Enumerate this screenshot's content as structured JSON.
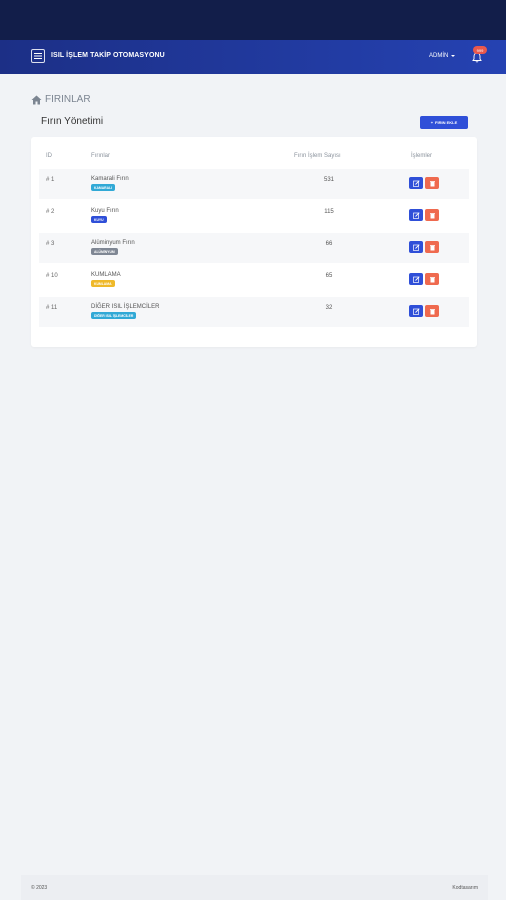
{
  "navbar": {
    "brand": "ISIL İŞLEM TAKİP OTOMASYONU",
    "user": "ADMİN",
    "notification_count": "999"
  },
  "page": {
    "heading": "FIRINLAR",
    "card_title": "Fırın Yönetimi",
    "add_button": "FIRIN EKLE"
  },
  "table": {
    "headers": [
      "ID",
      "Fırınlar",
      "Fırın İşlem Sayısı",
      "İşlemler"
    ],
    "rows": [
      {
        "id": "# 1",
        "name": "Kamarali Fırın",
        "badge": "KAMARALI",
        "badge_color": "#31a9d6",
        "count": "531"
      },
      {
        "id": "# 2",
        "name": "Kuyu Fırın",
        "badge": "KUYU",
        "badge_color": "#2f4fd8",
        "count": "115"
      },
      {
        "id": "# 3",
        "name": "Alüminyum Fırın",
        "badge": "ALÜMİNYUM",
        "badge_color": "#7f8794",
        "count": "66"
      },
      {
        "id": "# 10",
        "name": "KUMLAMA",
        "badge": "KUMLAMA",
        "badge_color": "#efb92a",
        "count": "65"
      },
      {
        "id": "# 11",
        "name": "DİĞER ISIL İŞLEMCİLER",
        "badge": "DİĞER ISIL İŞLEMCİLER",
        "badge_color": "#31a9d6",
        "count": "32"
      }
    ]
  },
  "footer": {
    "copyright": "© 2023",
    "credit": "Kodtasarım"
  },
  "colors": {
    "topbar": "#121e4a",
    "navbar": "#2542b2",
    "primary": "#2f4fd8",
    "danger": "#ef6a4f"
  }
}
